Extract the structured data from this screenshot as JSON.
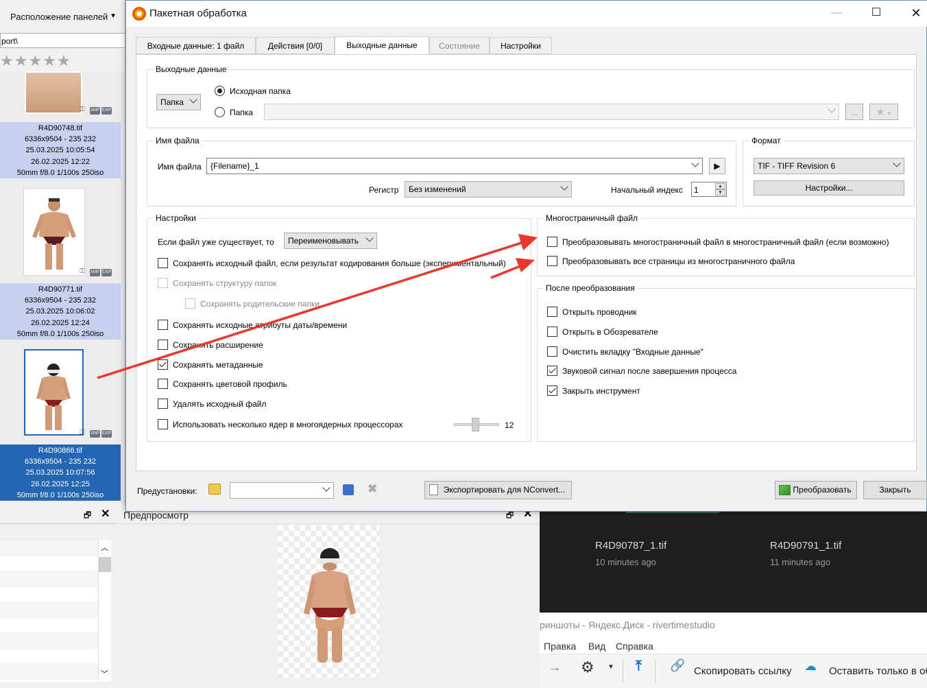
{
  "left_panel": {
    "layout_label": "Расположение панелей",
    "path": "port\\",
    "star_labels": [
      "2",
      "3",
      "4",
      "5"
    ],
    "thumbnails": [
      {
        "filename": "R4D90748.tif",
        "size": "6336x9504 - 235 232",
        "date1": "25.03.2025 10:05:54",
        "date2": "26.02.2025 12:22",
        "exif": "50mm f/8.0 1/100s 250iso"
      },
      {
        "filename": "R4D90771.tif",
        "size": "6336x9504 - 235 232",
        "date1": "25.03.2025 10:06:02",
        "date2": "26.02.2025 12:24",
        "exif": "50mm f/8.0 1/100s 250iso"
      },
      {
        "filename": "R4D90866.tif",
        "size": "6336x9504 - 235 232",
        "date1": "25.03.2025 10:07:56",
        "date2": "26.02.2025 12:25",
        "exif": "50mm f/8.0 1/100s 250iso"
      }
    ],
    "badge_xmp": "XMP",
    "badge_exif": "EXIF"
  },
  "preview_panel": {
    "title": "Предпросмотр"
  },
  "dark_area": {
    "files": [
      {
        "name": "R4D90787_1.tif",
        "time": "10 minutes ago"
      },
      {
        "name": "R4D90791_1.tif",
        "time": "11 minutes ago"
      }
    ]
  },
  "explorer": {
    "title": "риншоты - Яндекс.Диск - rivertimestudio",
    "menu": [
      "Правка",
      "Вид",
      "Справка"
    ],
    "copy_link": "Скопировать ссылку",
    "leave_only": "Оставить только в об"
  },
  "dialog": {
    "title": "Пакетная обработка",
    "tabs": [
      "Входные данные: 1 файл",
      "Действия [0/0]",
      "Выходные данные",
      "Состояние",
      "Настройки"
    ],
    "output_group": {
      "title": "Выходные данные",
      "dest_combo": "Папка",
      "radio_source": "Исходная папка",
      "radio_folder": "Папка",
      "browse": "..."
    },
    "filename_group": {
      "title": "Имя файла",
      "label": "Имя файла",
      "value": "{Filename}_1",
      "case_label": "Регистр",
      "case_value": "Без изменений",
      "start_index_label": "Начальный индекс",
      "start_index": "1"
    },
    "format_group": {
      "title": "Формат",
      "value": "TIF - TIFF Revision 6",
      "settings_btn": "Настройки..."
    },
    "settings_group": {
      "title": "Настройки",
      "if_exists_label": "Если файл уже существует, то",
      "if_exists_value": "Переименовывать",
      "options": [
        {
          "label": "Сохранять исходный файл, если результат кодирования больше (экспериментальный)",
          "checked": false
        },
        {
          "label": "Сохранять структуру папок",
          "checked": false,
          "disabled": true
        },
        {
          "label": "Сохранять родительские папки",
          "checked": false,
          "disabled": true
        },
        {
          "label": "Сохранять исходные атрибуты даты/времени",
          "checked": false
        },
        {
          "label": "Сохранять расширение",
          "checked": false
        },
        {
          "label": "Сохранять метаданные",
          "checked": true
        },
        {
          "label": "Сохранять цветовой профиль",
          "checked": false
        },
        {
          "label": "Удалять исходный файл",
          "checked": false
        },
        {
          "label": "Использовать несколько ядер в многоядерных процессорах",
          "checked": false
        }
      ],
      "cores_value": "12"
    },
    "multipage_group": {
      "title": "Многостраничный файл",
      "options": [
        {
          "label": "Преобразовывать многостраничный файл в многостраничный файл (если возможно)",
          "checked": false
        },
        {
          "label": "Преобразовывать все страницы из многостраничного файла",
          "checked": false
        }
      ]
    },
    "after_group": {
      "title": "После преобразования",
      "options": [
        {
          "label": "Открыть проводник",
          "checked": false
        },
        {
          "label": "Открыть в Обозревателе",
          "checked": false
        },
        {
          "label": "Очистить вкладку \"Входные данные\"",
          "checked": false
        },
        {
          "label": "Звуковой сигнал после завершения процесса",
          "checked": true
        },
        {
          "label": "Закрыть инструмент",
          "checked": true
        }
      ]
    },
    "footer": {
      "presets_label": "Предустановки:",
      "export_btn": "Экспортировать для NConvert...",
      "convert_btn": "Преобразовать",
      "close_btn": "Закрыть"
    }
  },
  "colors": {
    "arrow": "#e8382d",
    "selected_blue": "#2566b3",
    "selected_light": "#c8d0f0"
  }
}
